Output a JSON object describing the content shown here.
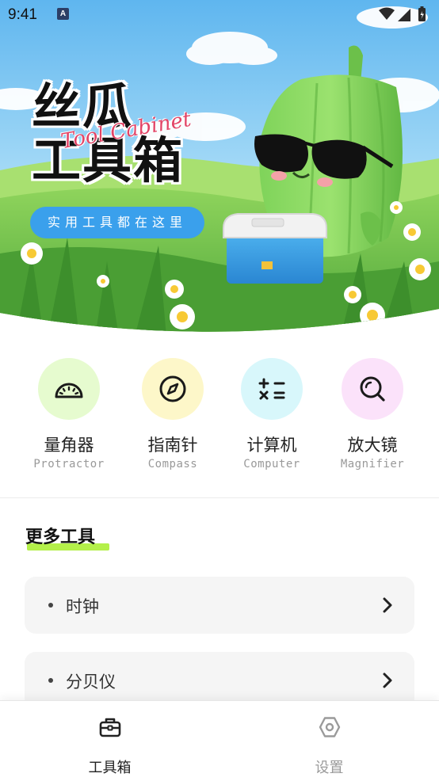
{
  "status_bar": {
    "time": "9:41",
    "notification_badge": "A"
  },
  "hero": {
    "title_line1": "丝瓜",
    "title_line2": "工具箱",
    "title_script": "Tool Cabinet",
    "slogan": "实用工具都在这里",
    "colors": {
      "sky": "#8fd0f5",
      "grass": "#6cc04a",
      "pill": "#3aa0ec",
      "script": "#e24466"
    }
  },
  "tools": [
    {
      "name": "量角器",
      "en": "Protractor",
      "icon": "protractor-icon",
      "bg": "#e6fbcf"
    },
    {
      "name": "指南针",
      "en": "Compass",
      "icon": "compass-icon",
      "bg": "#fdf7c9"
    },
    {
      "name": "计算机",
      "en": "Computer",
      "icon": "calculator-icon",
      "bg": "#d8f7fb"
    },
    {
      "name": "放大镜",
      "en": "Magnifier",
      "icon": "magnifier-icon",
      "bg": "#fbe2fa"
    }
  ],
  "more_tools": {
    "title": "更多工具",
    "accent": "#b4f04a",
    "items": [
      {
        "label": "时钟"
      },
      {
        "label": "分贝仪"
      }
    ]
  },
  "bottom_nav": {
    "items": [
      {
        "label": "工具箱",
        "icon": "toolbox-icon",
        "active": true,
        "color": "#222222"
      },
      {
        "label": "设置",
        "icon": "settings-icon",
        "active": false,
        "color": "#9a9a9a"
      }
    ]
  }
}
